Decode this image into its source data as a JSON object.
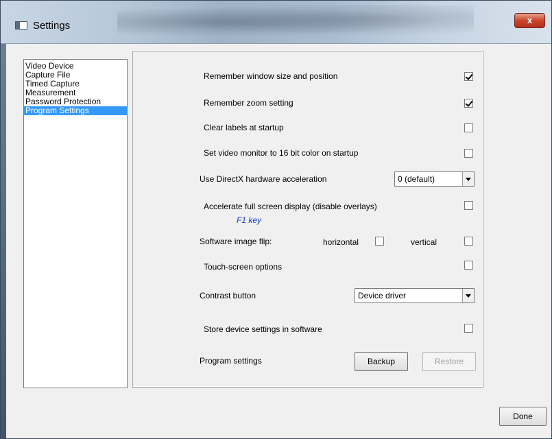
{
  "window": {
    "title": "Settings",
    "close_label": "x"
  },
  "nav": {
    "items": [
      {
        "label": "Video Device"
      },
      {
        "label": "Capture File"
      },
      {
        "label": "Timed Capture"
      },
      {
        "label": "Measurement"
      },
      {
        "label": "Password Protection"
      },
      {
        "label": "Program Settings",
        "selected": true
      }
    ]
  },
  "settings": {
    "remember_window": {
      "label": "Remember window size and position",
      "checked": true
    },
    "remember_zoom": {
      "label": "Remember zoom setting",
      "checked": true
    },
    "clear_labels": {
      "label": "Clear labels at startup",
      "checked": false
    },
    "video_monitor_16bit": {
      "label": "Set video monitor to 16 bit color on startup",
      "checked": false
    },
    "directx": {
      "label": "Use DirectX hardware acceleration",
      "value": "0 (default)"
    },
    "accelerate_fullscreen": {
      "label": "Accelerate full screen display (disable overlays)",
      "hint": "F1 key",
      "checked": false
    },
    "image_flip": {
      "label": "Software image flip:",
      "horizontal_label": "horizontal",
      "horizontal_checked": false,
      "vertical_label": "vertical",
      "vertical_checked": false
    },
    "touch_screen": {
      "label": "Touch-screen options",
      "checked": false
    },
    "contrast_button": {
      "label": "Contrast button",
      "value": "Device driver"
    },
    "store_device": {
      "label": "Store device settings in software",
      "checked": false
    },
    "program_settings": {
      "label": "Program settings",
      "backup_label": "Backup",
      "restore_label": "Restore"
    }
  },
  "footer": {
    "done_label": "Done"
  }
}
